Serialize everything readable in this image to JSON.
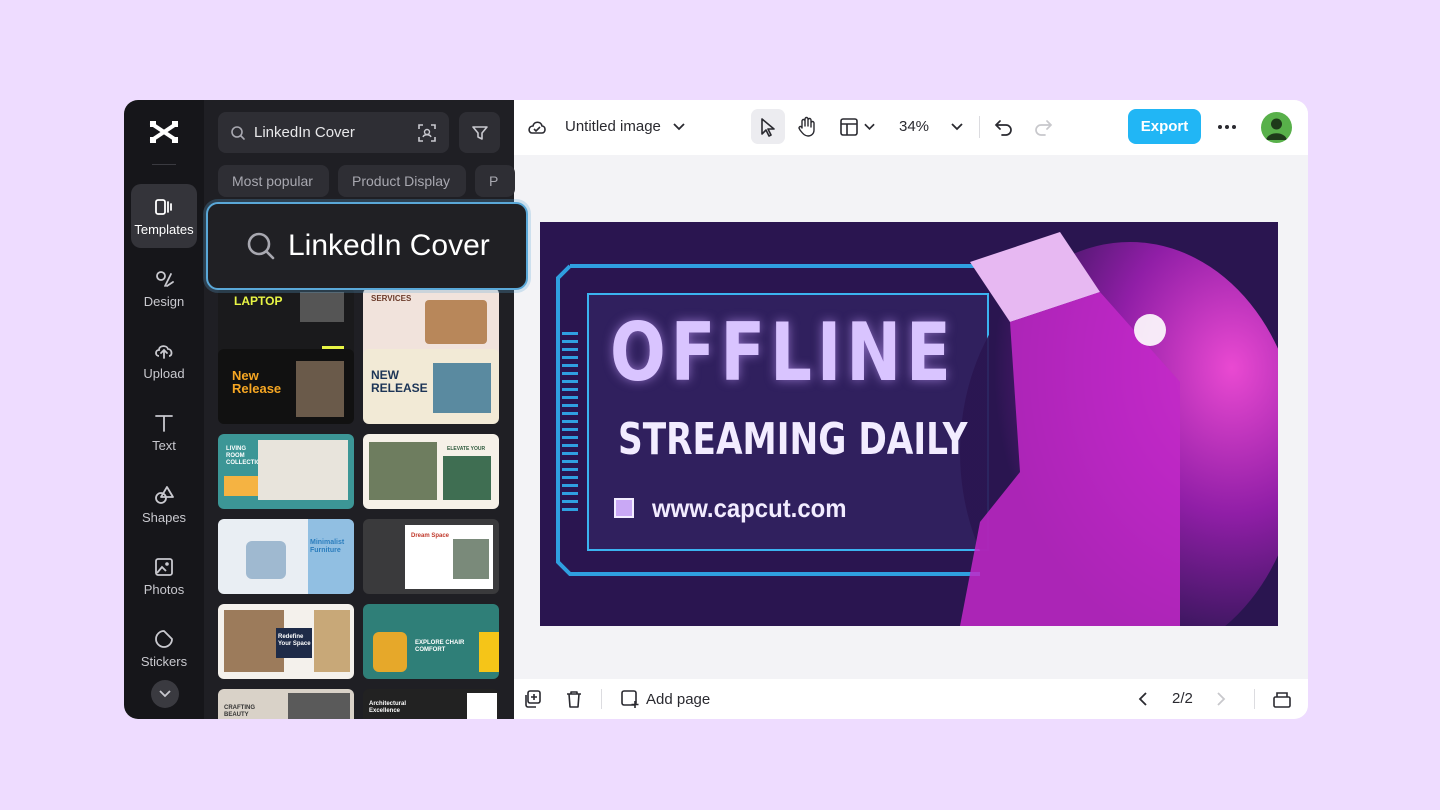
{
  "nav": {
    "items": [
      {
        "label": "Templates",
        "icon": "templates-icon"
      },
      {
        "label": "Design",
        "icon": "design-icon"
      },
      {
        "label": "Upload",
        "icon": "upload-icon"
      },
      {
        "label": "Text",
        "icon": "text-icon"
      },
      {
        "label": "Shapes",
        "icon": "shapes-icon"
      },
      {
        "label": "Photos",
        "icon": "photos-icon"
      },
      {
        "label": "Stickers",
        "icon": "stickers-icon"
      }
    ]
  },
  "panel": {
    "search_value": "LinkedIn Cover",
    "chips": [
      "Most popular",
      "Product Display",
      "P"
    ],
    "thumbs": [
      {
        "title": "LAPTOP"
      },
      {
        "title": "SERVICES"
      },
      {
        "title": "New Release"
      },
      {
        "title": "NEW RELEASE"
      },
      {
        "title": "LIVING ROOM COLLECTION"
      },
      {
        "title": "ELEVATE YOUR SPACE"
      },
      {
        "title": "Minimalist Furniture"
      },
      {
        "title": "Dream Space"
      },
      {
        "title": "Redefine Your Space"
      },
      {
        "title": "EXPLORE CHAIR COMFORT"
      },
      {
        "title": "CRAFTING BEAUTY"
      },
      {
        "title": "Architectural Excellence"
      }
    ]
  },
  "callout": {
    "text": "LinkedIn Cover"
  },
  "topbar": {
    "doc_title": "Untitled image",
    "zoom": "34%",
    "export_label": "Export"
  },
  "canvas": {
    "headline": "OFFLINE",
    "subheadline": "STREAMING DAILY",
    "url": "www.capcut.com"
  },
  "bottombar": {
    "add_page_label": "Add page",
    "page_indicator": "2/2"
  },
  "colors": {
    "background": "#eedcff",
    "accent": "#21b6f5",
    "canvas_bg": "#2a1550",
    "headline": "#d9c4ff"
  }
}
